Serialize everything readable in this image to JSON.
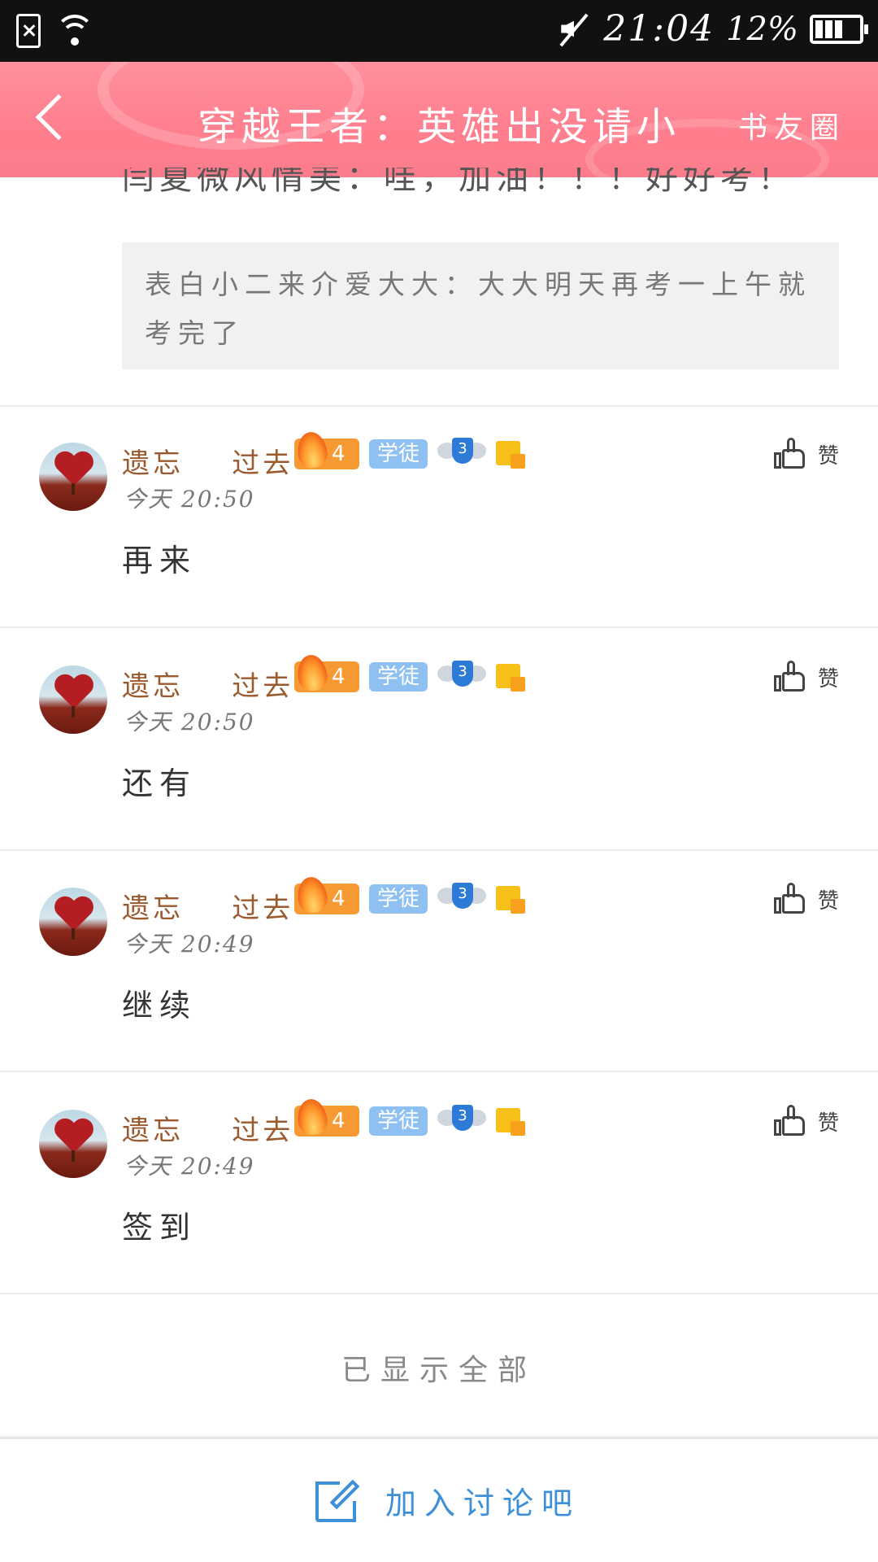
{
  "status_bar": {
    "time": "21:04",
    "battery_pct": "12%"
  },
  "header": {
    "title": "穿越王者：英雄出没请小",
    "action": "书友圈"
  },
  "truncated_line": "闫夏微风情美：哇，加油！！！好好考！",
  "quote": {
    "text": "表白小二来介爱大大：大大明天再考一上午就考完了"
  },
  "comments": [
    {
      "user": "遗忘    过去",
      "level": "4",
      "role": "学徒",
      "shield_level": "3",
      "time": "今天 20:50",
      "text": "再来",
      "like_label": "赞"
    },
    {
      "user": "遗忘    过去",
      "level": "4",
      "role": "学徒",
      "shield_level": "3",
      "time": "今天 20:50",
      "text": "还有",
      "like_label": "赞"
    },
    {
      "user": "遗忘    过去",
      "level": "4",
      "role": "学徒",
      "shield_level": "3",
      "time": "今天 20:49",
      "text": "继续",
      "like_label": "赞"
    },
    {
      "user": "遗忘    过去",
      "level": "4",
      "role": "学徒",
      "shield_level": "3",
      "time": "今天 20:49",
      "text": "签到",
      "like_label": "赞"
    }
  ],
  "footer_note": "已显示全部",
  "bottom_bar": {
    "join_label": "加入讨论吧"
  },
  "colors": {
    "header_pink": "#ff7f8f",
    "username_brown": "#9a5a2e",
    "link_blue": "#3d8fd8",
    "level_orange": "#f89a34",
    "role_blue": "#8ec0f2"
  }
}
